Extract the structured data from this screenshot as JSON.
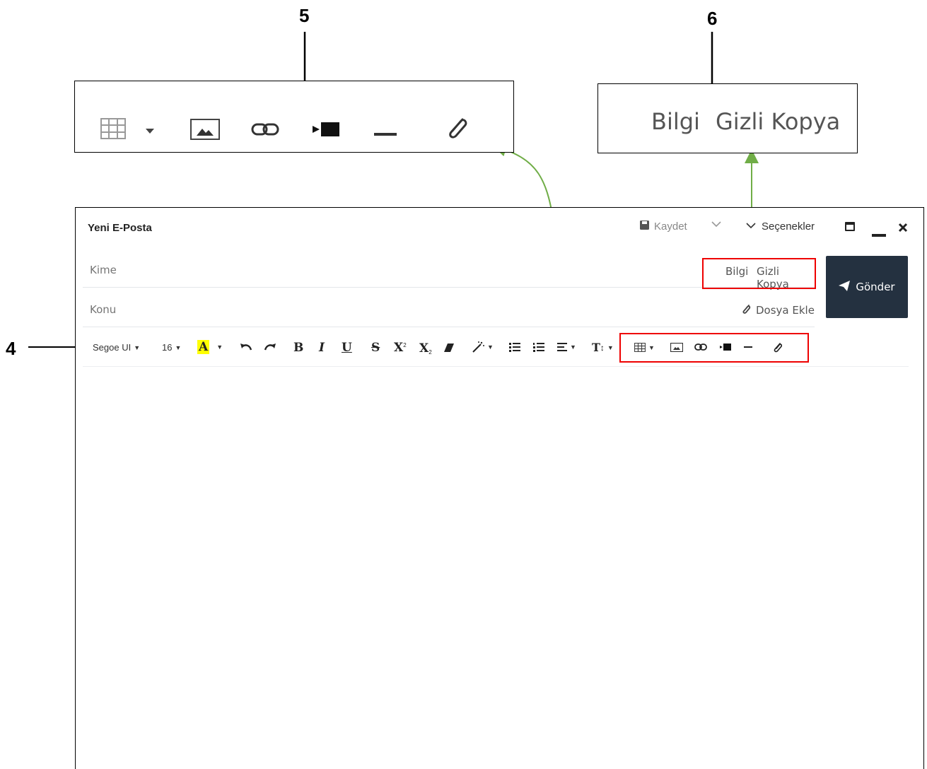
{
  "callouts": {
    "c4": "4",
    "c5": "5",
    "c6": "6"
  },
  "zoom_recipients": {
    "cc": "Bilgi",
    "bcc": "Gizli Kopya"
  },
  "window": {
    "title": "Yeni E-Posta",
    "save_label": "Kaydet",
    "options_label": "Seçenekler"
  },
  "fields": {
    "to_placeholder": "Kime",
    "subject_placeholder": "Konu",
    "cc_label": "Bilgi",
    "bcc_label": "Gizli Kopya",
    "attach_label": "Dosya Ekle"
  },
  "send": {
    "label": "Gönder"
  },
  "format_toolbar": {
    "font_family": "Segoe UI",
    "font_size": "16",
    "highlight_letter": "A",
    "bold": "B",
    "italic": "I",
    "underline": "U",
    "strike": "S",
    "superscript": "X",
    "subscript": "X",
    "text_size": "T"
  },
  "colors": {
    "send_button": "#243140",
    "highlight": "#ffff00",
    "annotation_box": "#ee0000",
    "annotation_arrow": "#70ad47"
  }
}
